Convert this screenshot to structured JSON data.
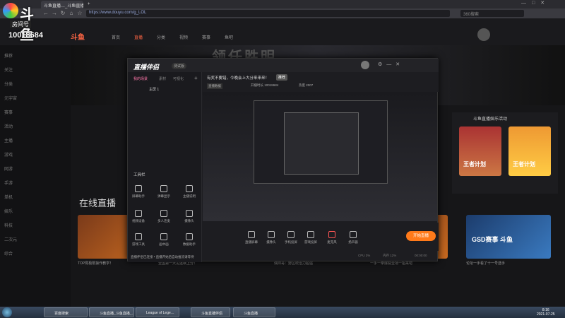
{
  "browser": {
    "tabs": [
      "斗鱼直播…_斗鱼直播_斗鱼…",
      "斗鱼直播"
    ],
    "new_tab": "+",
    "url": "https://www.douyu.com/g_LOL",
    "search_placeholder": "360搜索",
    "nav": [
      "←",
      "→",
      "↻",
      "⌂",
      "☆"
    ],
    "window_controls": [
      "—",
      "□",
      "✕"
    ]
  },
  "overlay": {
    "logo_text": "斗鱼",
    "room_label": "房间号",
    "room_id": "10018684"
  },
  "site": {
    "logo": "斗鱼",
    "nav": [
      "首页",
      "直播",
      "分类",
      "视频",
      "赛事",
      "鱼吧"
    ],
    "sidebar": [
      "推荐",
      "关注",
      "分类",
      "元宇宙",
      "赛事",
      "活动",
      "主播",
      "游戏",
      "网游",
      "手游",
      "单机",
      "娱乐",
      "科技",
      "二次元",
      "综合"
    ],
    "banner_title": "领任胜明",
    "live_title": "在线直播",
    "cards": [
      {
        "caption": "TOP局极限操作教学！"
      },
      {
        "caption": "全国第一大龙连续上分！"
      },
      {
        "caption": "偶帅哥：野区统治力超强"
      },
      {
        "caption": "一手一拳爆裂全场一姐来吧"
      },
      {
        "caption": "论坛一手看了十一号选手"
      },
      {
        "caption": "GSD赛事 斗鱼"
      }
    ],
    "right_panel_title": "斗鱼直播娱乐活动",
    "right_banner": [
      "王者计划",
      "王者计划"
    ]
  },
  "app": {
    "name": "直播伴侣",
    "version": "测试版",
    "tabs": [
      "我的场景",
      "素材",
      "可视化"
    ],
    "scene_name": "主屏 1",
    "tools_title": "工具栏",
    "tools": [
      "屏幕助手",
      "弹幕显示",
      "主播说明",
      "视频设备",
      "多人连麦",
      "摄像头",
      "游戏工具",
      "画中画",
      "数据助手",
      "音乐",
      "其他",
      "更多"
    ],
    "notice": "有奖不要错，今晚会上大分来来来！",
    "notice_badge": "推荐",
    "stats": [
      "直播数据",
      "开播时长 10018684",
      "热度 2007"
    ],
    "controls": [
      "直播屏幕",
      "摄像头",
      "手机投屏",
      "游戏投屏",
      "麦克风",
      "扬声器"
    ],
    "start_button": "开始直播",
    "status": "直播伴侣已连接 • 直播开始后自动推流请等待",
    "status_right": [
      "CPU 3%",
      "内存 12%",
      "00:00:00"
    ]
  },
  "taskbar": {
    "items": [
      "百度搜索",
      "斗鱼直播_斗鱼直播_…",
      "",
      "League of Lege…",
      "",
      "斗鱼直播伴侣",
      "斗鱼直播"
    ],
    "time": "8:16",
    "date": "2021-07-25"
  },
  "colors": {
    "accent": "#ff7a1a",
    "bg": "#0d0d10"
  }
}
